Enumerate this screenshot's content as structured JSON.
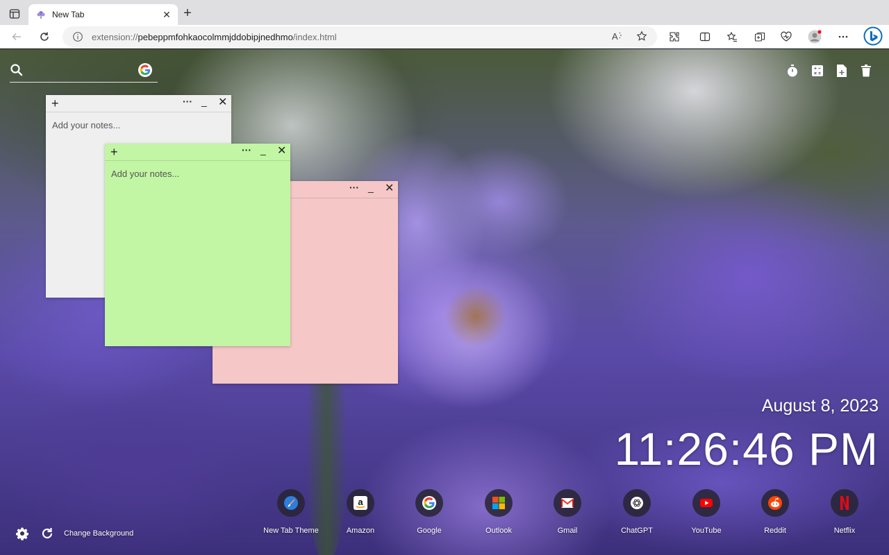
{
  "browser": {
    "tab_title": "New Tab",
    "url_prefix": "extension://",
    "url_host": "pebeppmfohkaocolmmjddobipjnedhmo",
    "url_path": "/index.html"
  },
  "search": {
    "placeholder": "",
    "engine_icon": "google-icon"
  },
  "top_tools": [
    "timer-icon",
    "calculator-icon",
    "add-note-icon",
    "trash-icon"
  ],
  "notes": [
    {
      "color": "#efefef",
      "placeholder": "Add your notes..."
    },
    {
      "color": "#c2f5a4",
      "placeholder": "Add your notes..."
    },
    {
      "color": "#f6c7c7",
      "placeholder": ""
    }
  ],
  "datetime": {
    "date": "August 8, 2023",
    "time": "11:26:46 PM"
  },
  "shortcuts": [
    {
      "label": "New Tab Theme",
      "icon": "theme-icon"
    },
    {
      "label": "Amazon",
      "icon": "amazon-icon"
    },
    {
      "label": "Google",
      "icon": "google-icon"
    },
    {
      "label": "Outlook",
      "icon": "outlook-icon"
    },
    {
      "label": "Gmail",
      "icon": "gmail-icon"
    },
    {
      "label": "ChatGPT",
      "icon": "chatgpt-icon"
    },
    {
      "label": "YouTube",
      "icon": "youtube-icon"
    },
    {
      "label": "Reddit",
      "icon": "reddit-icon"
    },
    {
      "label": "Netflix",
      "icon": "netflix-icon"
    }
  ],
  "footer": {
    "change_background": "Change Background"
  },
  "colors": {
    "accent_blue": "#0f6cbd",
    "text_white": "#ffffff"
  }
}
